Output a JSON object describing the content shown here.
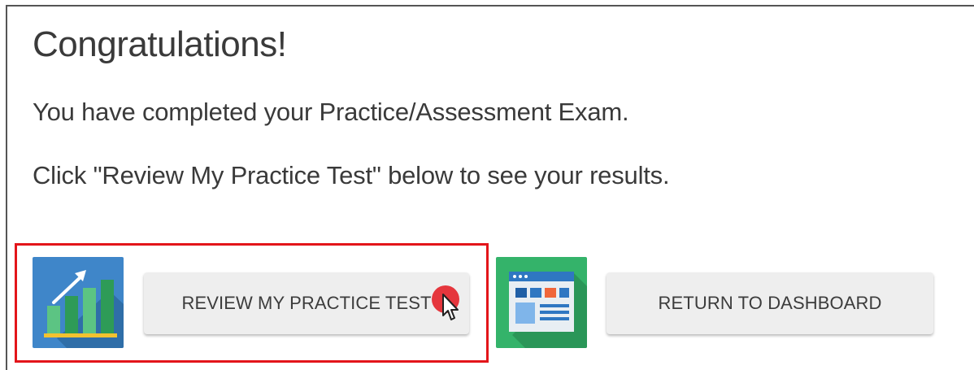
{
  "message": {
    "title": "Congratulations!",
    "line1": "You have completed your Practice/Assessment Exam.",
    "line2": "Click \"Review My Practice Test\" below to see your results."
  },
  "actions": {
    "review_label": "REVIEW MY PRACTICE TEST",
    "dashboard_label": "RETURN TO DASHBOARD"
  },
  "icons": {
    "review": "bar-chart-growth-icon",
    "dashboard": "dashboard-window-icon",
    "cursor": "arrow-cursor-icon"
  },
  "colors": {
    "highlight": "#e3151a",
    "review_tile_bg": "#3f86c9",
    "dashboard_tile_bg": "#34b36a",
    "click_indicator": "#e5363d",
    "button_bg": "#eeeeee"
  }
}
